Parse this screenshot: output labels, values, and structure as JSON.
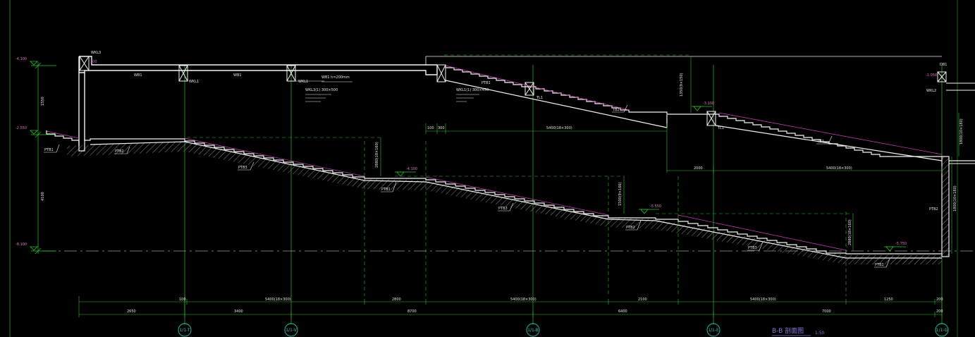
{
  "colors": {
    "background": "#000000",
    "outline": "#f2f2f2",
    "dimension": "#2fbf2f",
    "axis": "#2ec8a6",
    "nosing": "#d040c0",
    "hatch": "#8c8c8c",
    "title": "#8a78d8"
  },
  "title": {
    "name": "B-B 剖面图",
    "scale": "1:50"
  },
  "axes": [
    {
      "label": "1/1-T"
    },
    {
      "label": "1/1-V"
    },
    {
      "label": "1/1-B"
    },
    {
      "label": "1/1-E"
    },
    {
      "label": "1/1-G"
    }
  ],
  "level_marks": [
    {
      "label": "-4.100"
    },
    {
      "label": "-2.550"
    },
    {
      "label": "-8.100"
    }
  ],
  "elevation_marks": [
    {
      "label": "-4.100"
    },
    {
      "label": "-5.550"
    },
    {
      "label": "-5.750"
    },
    {
      "label": "-3.100"
    },
    {
      "label": "-1.050"
    }
  ],
  "left_dimensions": [
    {
      "label": "1550"
    },
    {
      "label": "4100"
    }
  ],
  "top_dimensions": [
    {
      "label": "100"
    },
    {
      "label": "300"
    },
    {
      "label": "5400(18×300)"
    },
    {
      "label": "2000"
    },
    {
      "label": "5400(18×300)"
    }
  ],
  "vertical_dimensions": [
    {
      "label": "2880(18×160)"
    },
    {
      "label": "1500(9×166)"
    },
    {
      "label": "2880(18×160)"
    },
    {
      "label": "1350(9×150)"
    },
    {
      "label": "1800(10×180)"
    },
    {
      "label": "1800(10×180)"
    }
  ],
  "bottom_dimensions_row1": [
    {
      "label": "100"
    },
    {
      "label": "5400(18×300)"
    },
    {
      "label": "2800"
    },
    {
      "label": "5400(18×300)"
    },
    {
      "label": "2100"
    },
    {
      "label": "5400(18×300)"
    },
    {
      "label": "1250"
    },
    {
      "label": "200"
    }
  ],
  "bottom_dimensions_row2": [
    {
      "label": "2650"
    },
    {
      "label": "3400"
    },
    {
      "label": "8700"
    },
    {
      "label": "6400"
    },
    {
      "label": "7000"
    },
    {
      "label": "200"
    }
  ],
  "stair_tags": [
    {
      "label": "PTB1"
    },
    {
      "label": "PTB2"
    },
    {
      "label": "PTB3"
    },
    {
      "label": "PTB1"
    },
    {
      "label": "PTB3"
    },
    {
      "label": "PTB2"
    },
    {
      "label": "PTB3"
    },
    {
      "label": "PTB1"
    },
    {
      "label": "TB2"
    },
    {
      "label": "PTB2"
    },
    {
      "label": "TB2"
    },
    {
      "label": "PTB1"
    }
  ],
  "beam_tags": [
    {
      "label": "WKL3"
    },
    {
      "label": "WB1"
    },
    {
      "label": "WKL1"
    },
    {
      "label": "WB1"
    },
    {
      "label": "WKL1"
    },
    {
      "label": "TL1"
    },
    {
      "label": "TL1"
    },
    {
      "label": "DB1"
    },
    {
      "label": "WKL2"
    },
    {
      "label": "300"
    }
  ],
  "notes": [
    {
      "label": "WB1 h=200mm"
    },
    {
      "label": "WKL3(1) 300×500"
    },
    {
      "label": "WKL1(1) 300×450"
    }
  ]
}
